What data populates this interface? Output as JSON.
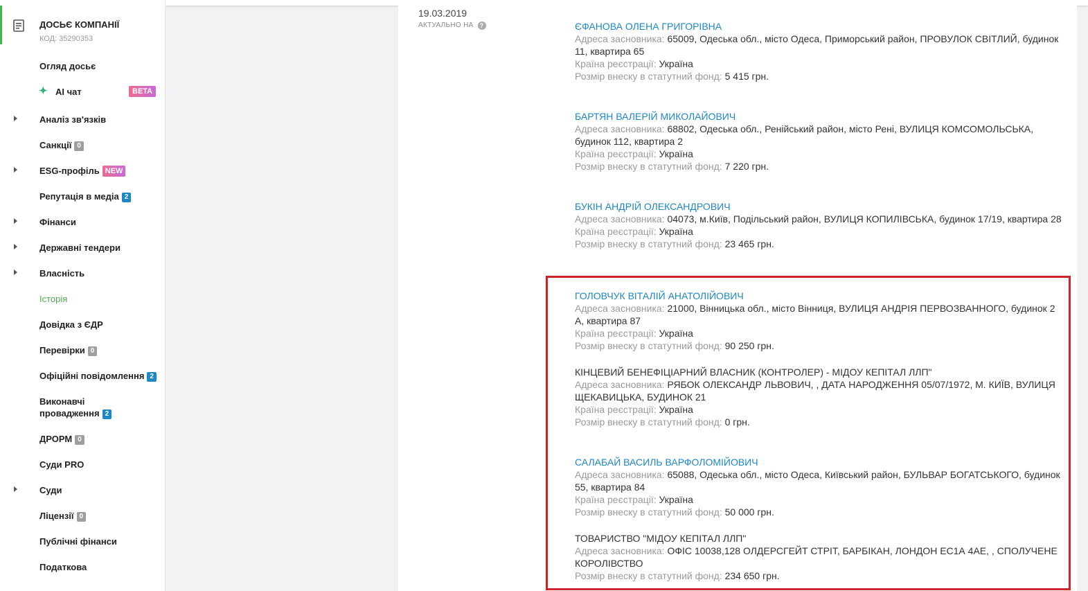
{
  "sidebar": {
    "dossier_title": "ДОСЬЄ КОМПАНІЇ",
    "dossier_code": "КОД: 35290353",
    "items": [
      {
        "label": "Огляд досьє",
        "arrow": false
      },
      {
        "label": "AI чат",
        "arrow": false,
        "badge": "BETA"
      },
      {
        "label": "Аналіз зв'язків",
        "arrow": true
      },
      {
        "label": "Санкції",
        "arrow": false,
        "badge": "0"
      },
      {
        "label": "ESG-профіль",
        "arrow": true,
        "badge": "NEW"
      },
      {
        "label": "Репутація в медіа",
        "arrow": false,
        "badge": "2"
      },
      {
        "label": "Фінанси",
        "arrow": true
      },
      {
        "label": "Державні тендери",
        "arrow": true
      },
      {
        "label": "Власність",
        "arrow": true
      },
      {
        "label": "Історія",
        "arrow": false,
        "active": true
      },
      {
        "label": "Довідка з ЄДР",
        "arrow": false
      },
      {
        "label": "Перевірки",
        "arrow": false,
        "badge": "0"
      },
      {
        "label": "Офіційні повідомлення",
        "arrow": false,
        "badge": "2"
      },
      {
        "label": "Виконавчі",
        "label2": "провадження",
        "arrow": false,
        "badge": "2"
      },
      {
        "label": "ДРОРМ",
        "arrow": false,
        "badge": "0"
      },
      {
        "label": "Суди PRO",
        "arrow": false
      },
      {
        "label": "Суди",
        "arrow": true
      },
      {
        "label": "Ліцензії",
        "arrow": false,
        "badge": "0"
      },
      {
        "label": "Публічні фінанси",
        "arrow": false
      },
      {
        "label": "Податкова",
        "arrow": false
      }
    ]
  },
  "header": {
    "date": "19.03.2019",
    "actual_label": "АКТУАЛЬНО НА",
    "help_glyph": "?"
  },
  "labels": {
    "address": "Адреса засновника:",
    "country": "Країна реєстрації:",
    "capital": "Розмір внеску в статутний фонд:"
  },
  "founders": [
    {
      "name": "ЄФАНОВА ОЛЕНА ГРИГОРІВНА",
      "link": true,
      "address": "65009, Одеська обл., місто Одеса, Приморський район, ПРОВУЛОК СВІТЛИЙ, будинок 11, квартира 65",
      "country": "Україна",
      "capital": "5 415 грн."
    },
    {
      "name": "БАРТЯН ВАЛЕРІЙ МИКОЛАЙОВИЧ",
      "link": true,
      "address": "68802, Одеська обл., Ренійський район, місто Рені, ВУЛИЦЯ КОМСОМОЛЬСЬКА, будинок 112, квартира 2",
      "country": "Україна",
      "capital": "7 220 грн."
    },
    {
      "name": "БУКІН АНДРІЙ ОЛЕКСАНДРОВИЧ",
      "link": true,
      "address": "04073, м.Київ, Подільський район, ВУЛИЦЯ КОПИЛІВСЬКА, будинок 17/19, квартира 28",
      "country": "Україна",
      "capital": "23 465 грн."
    },
    {
      "name": "ГОЛОВЧУК ВІТАЛІЙ АНАТОЛІЙОВИЧ",
      "link": true,
      "address": "21000, Вінницька обл., місто Вінниця, ВУЛИЦЯ АНДРІЯ ПЕРВОЗВАННОГО, будинок 2 А, квартира 87",
      "country": "Україна",
      "capital": "90 250 грн."
    },
    {
      "name": "КІНЦЕВИЙ БЕНЕФІЦІАРНИЙ ВЛАСНИК (КОНТРОЛЕР) - МІДОУ КЕПІТАЛ ЛЛП\"",
      "link": false,
      "address": "РЯБОК ОЛЕКСАНДР ЛЬВОВИЧ, , ДАТА НАРОДЖЕННЯ 05/07/1972, М. КИЇВ, ВУЛИЦЯ ЩЕКАВИЦЬКА, БУДИНОК 21",
      "country": "Україна",
      "capital": "0 грн."
    },
    {
      "name": "САЛАБАЙ ВАСИЛЬ ВАРФОЛОМІЙОВИЧ",
      "link": true,
      "address": "65088, Одеська обл., місто Одеса, Київський район, БУЛЬВАР БОГАТСЬКОГО, будинок 55, квартира 84",
      "country": "Україна",
      "capital": "50 000 грн."
    },
    {
      "name": "ТОВАРИСТВО \"МІДОУ КЕПІТАЛ ЛЛП\"",
      "link": false,
      "address": "ОФІС 10038,128 ОЛДЕРСГЕЙТ СТРІТ, БАРБІКАН, ЛОНДОН ЕС1А 4АЕ, , СПОЛУЧЕНЕ КОРОЛІВСТВО",
      "capital": "234 650 грн."
    }
  ]
}
